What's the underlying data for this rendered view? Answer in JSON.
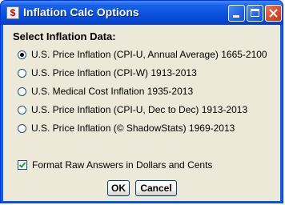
{
  "window": {
    "title": "Inflation Calc Options",
    "app_icon": "dollar-icon",
    "controls": [
      "minimize-icon",
      "maximize-icon",
      "close-icon"
    ]
  },
  "section": {
    "heading": "Select Inflation Data:"
  },
  "options": [
    {
      "label": "U.S. Price Inflation (CPI-U, Annual Average) 1665-2100",
      "selected": true
    },
    {
      "label": "U.S. Price Inflation (CPI-W) 1913-2013",
      "selected": false
    },
    {
      "label": "U.S. Medical Cost Inflation 1935-2013",
      "selected": false
    },
    {
      "label": "U.S. Price Inflation (CPI-U, Dec to Dec) 1913-2013",
      "selected": false
    },
    {
      "label": "U.S. Price Inflation (© ShadowStats) 1969-2013",
      "selected": false
    }
  ],
  "format_option": {
    "label": "Format Raw Answers in Dollars and Cents",
    "checked": true
  },
  "buttons": {
    "ok": "OK",
    "cancel": "Cancel"
  },
  "colors": {
    "titlebar": "#0a54df",
    "client_bg": "#ece9d8",
    "close_button": "#d84a24"
  }
}
